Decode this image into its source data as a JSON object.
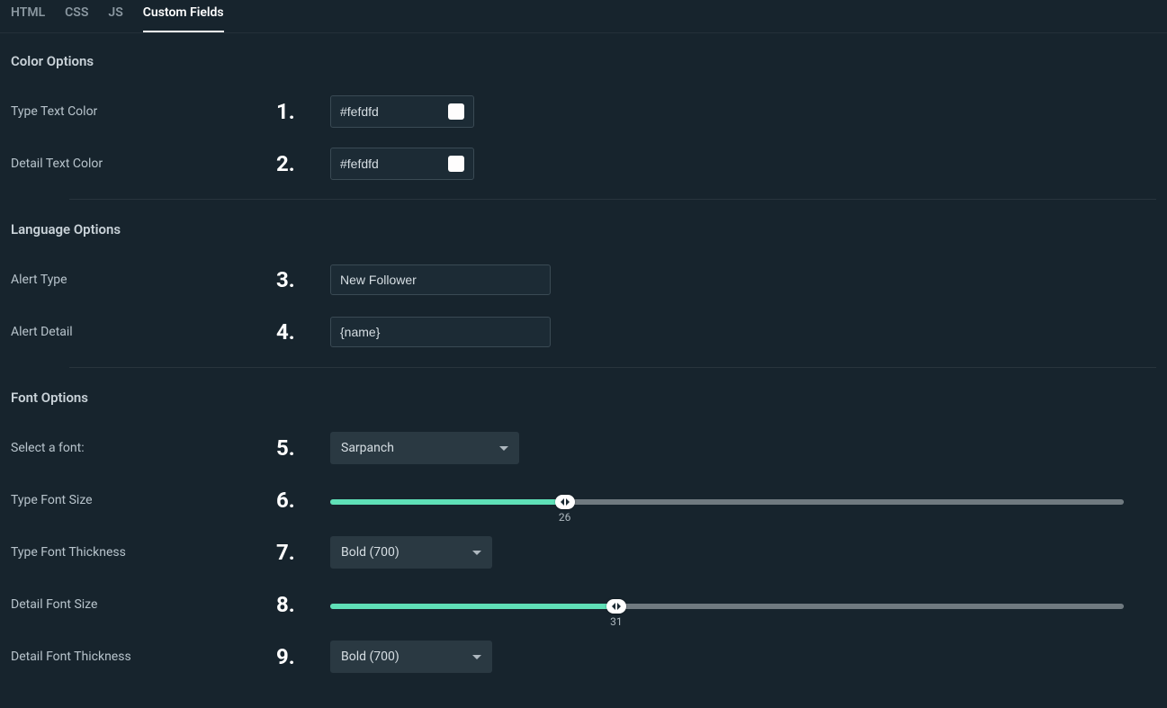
{
  "tabs": [
    {
      "label": "HTML",
      "active": false
    },
    {
      "label": "CSS",
      "active": false
    },
    {
      "label": "JS",
      "active": false
    },
    {
      "label": "Custom Fields",
      "active": true
    }
  ],
  "sections": {
    "color": {
      "heading": "Color Options",
      "type_text_color": {
        "label": "Type Text Color",
        "num": "1.",
        "value": "#fefdfd",
        "swatch": "#fefdfd"
      },
      "detail_text_color": {
        "label": "Detail Text Color",
        "num": "2.",
        "value": "#fefdfd",
        "swatch": "#fefdfd"
      }
    },
    "language": {
      "heading": "Language Options",
      "alert_type": {
        "label": "Alert Type",
        "num": "3.",
        "value": "New Follower"
      },
      "alert_detail": {
        "label": "Alert Detail",
        "num": "4.",
        "value": "{name}"
      }
    },
    "font": {
      "heading": "Font Options",
      "select_font": {
        "label": "Select a font:",
        "num": "5.",
        "value": "Sarpanch"
      },
      "type_font_size": {
        "label": "Type Font Size",
        "num": "6.",
        "value": 26,
        "min": 0,
        "max": 88
      },
      "type_font_thickness": {
        "label": "Type Font Thickness",
        "num": "7.",
        "value": "Bold (700)"
      },
      "detail_font_size": {
        "label": "Detail Font Size",
        "num": "8.",
        "value": 31,
        "min": 0,
        "max": 86
      },
      "detail_font_thickness": {
        "label": "Detail Font Thickness",
        "num": "9.",
        "value": "Bold (700)"
      }
    }
  },
  "colors": {
    "accent": "#5fe0b7"
  }
}
